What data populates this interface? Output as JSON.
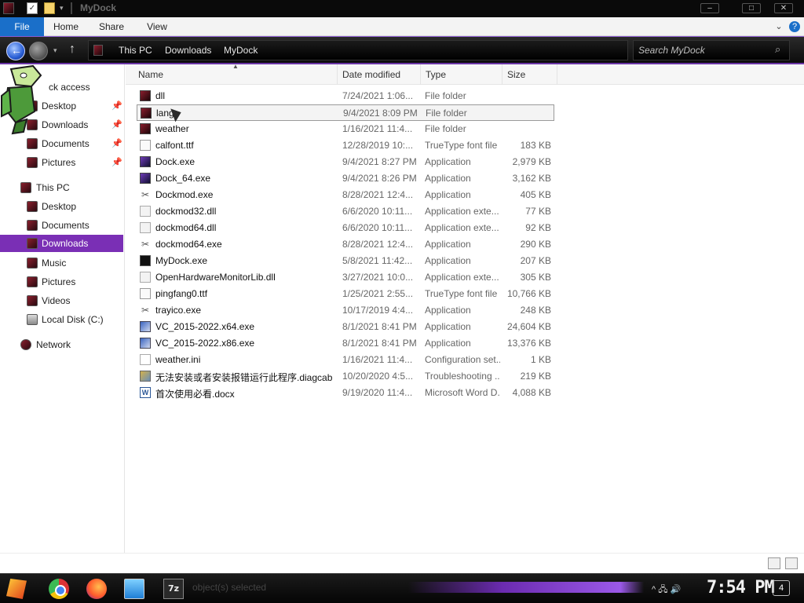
{
  "window": {
    "title": "MyDock",
    "minimize_glyph": "–",
    "maximize_glyph": "□",
    "close_glyph": "✕"
  },
  "ribbon": {
    "tabs": [
      "File",
      "Home",
      "Share",
      "View"
    ],
    "expand_glyph": "⌄",
    "help_glyph": "?"
  },
  "nav": {
    "back_glyph": "←",
    "up_glyph": "↑",
    "breadcrumb": [
      "This PC",
      "Downloads",
      "MyDock"
    ],
    "search_placeholder": "Search MyDock",
    "search_glyph": "⌕"
  },
  "sidebar": {
    "quick_access_label": "ck access",
    "items": [
      {
        "label": "Desktop",
        "pinned": true
      },
      {
        "label": "Downloads",
        "pinned": true
      },
      {
        "label": "Documents",
        "pinned": true
      },
      {
        "label": "Pictures",
        "pinned": true
      },
      {
        "label": "This PC",
        "pinned": false
      },
      {
        "label": "Desktop",
        "pinned": false
      },
      {
        "label": "Documents",
        "pinned": false
      },
      {
        "label": "Downloads",
        "pinned": false,
        "selected": true
      },
      {
        "label": "Music",
        "pinned": false
      },
      {
        "label": "Pictures",
        "pinned": false
      },
      {
        "label": "Videos",
        "pinned": false
      },
      {
        "label": "Local Disk (C:)",
        "pinned": false
      },
      {
        "label": "Network",
        "pinned": false
      }
    ],
    "pin_glyph": "📌"
  },
  "columns": [
    "Name",
    "Date modified",
    "Type",
    "Size"
  ],
  "files": [
    {
      "name": "dll",
      "date": "7/24/2021 1:06...",
      "type": "File folder",
      "size": "",
      "icon": "folder-icon"
    },
    {
      "name": "lang",
      "date": "9/4/2021 8:09 PM",
      "type": "File folder",
      "size": "",
      "icon": "folder-icon"
    },
    {
      "name": "weather",
      "date": "1/16/2021 11:4...",
      "type": "File folder",
      "size": "",
      "icon": "folder-icon"
    },
    {
      "name": "calfont.ttf",
      "date": "12/28/2019 10:...",
      "type": "TrueType font file",
      "size": "183 KB",
      "icon": "font-file-icon"
    },
    {
      "name": "Dock.exe",
      "date": "9/4/2021 8:27 PM",
      "type": "Application",
      "size": "2,979 KB",
      "icon": "app-icon"
    },
    {
      "name": "Dock_64.exe",
      "date": "9/4/2021 8:26 PM",
      "type": "Application",
      "size": "3,162 KB",
      "icon": "app-icon"
    },
    {
      "name": "Dockmod.exe",
      "date": "8/28/2021 12:4...",
      "type": "Application",
      "size": "405 KB",
      "icon": "tools-icon"
    },
    {
      "name": "dockmod32.dll",
      "date": "6/6/2020 10:11...",
      "type": "Application exte...",
      "size": "77 KB",
      "icon": "dll-icon"
    },
    {
      "name": "dockmod64.dll",
      "date": "6/6/2020 10:11...",
      "type": "Application exte...",
      "size": "92 KB",
      "icon": "dll-icon"
    },
    {
      "name": "dockmod64.exe",
      "date": "8/28/2021 12:4...",
      "type": "Application",
      "size": "290 KB",
      "icon": "tools-icon"
    },
    {
      "name": "MyDock.exe",
      "date": "5/8/2021 11:42...",
      "type": "Application",
      "size": "207 KB",
      "icon": "black-app-icon"
    },
    {
      "name": "OpenHardwareMonitorLib.dll",
      "date": "3/27/2021 10:0...",
      "type": "Application exte...",
      "size": "305 KB",
      "icon": "dll-icon"
    },
    {
      "name": "pingfang0.ttf",
      "date": "1/25/2021 2:55...",
      "type": "TrueType font file",
      "size": "10,766 KB",
      "icon": "font-file-icon"
    },
    {
      "name": "trayico.exe",
      "date": "10/17/2019 4:4...",
      "type": "Application",
      "size": "248 KB",
      "icon": "tools-icon"
    },
    {
      "name": "VC_2015-2022.x64.exe",
      "date": "8/1/2021 8:41 PM",
      "type": "Application",
      "size": "24,604 KB",
      "icon": "installer-icon"
    },
    {
      "name": "VC_2015-2022.x86.exe",
      "date": "8/1/2021 8:41 PM",
      "type": "Application",
      "size": "13,376 KB",
      "icon": "installer-icon"
    },
    {
      "name": "weather.ini",
      "date": "1/16/2021 11:4...",
      "type": "Configuration set...",
      "size": "1 KB",
      "icon": "ini-file-icon"
    },
    {
      "name": "无法安装或者安装报错运行此程序.diagcab",
      "date": "10/20/2020 4:5...",
      "type": "Troubleshooting ...",
      "size": "219 KB",
      "icon": "diagcab-icon"
    },
    {
      "name": "首次使用必看.docx",
      "date": "9/19/2020 11:4...",
      "type": "Microsoft Word D...",
      "size": "4,088 KB",
      "icon": "word-doc-icon"
    }
  ],
  "taskbar": {
    "status_text": "object(s) selected",
    "sevenzip_label": "7z",
    "clock": "7:54 PM",
    "tray_glyphs": "^ 🖧 🔊",
    "notification_count": "4"
  },
  "colors": {
    "accent": "#7a2fb5",
    "file_tab": "#1a6fc9"
  }
}
